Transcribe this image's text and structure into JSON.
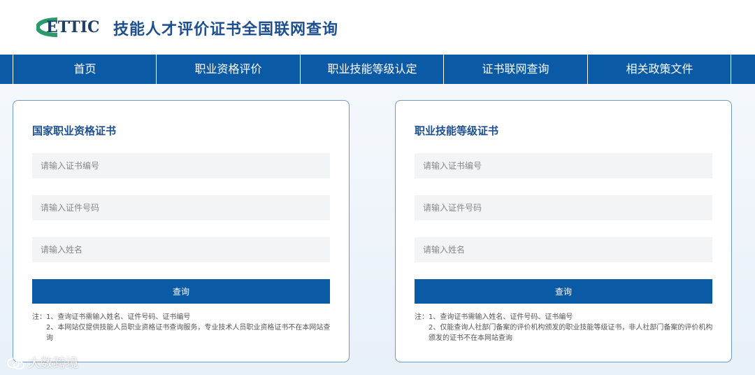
{
  "header": {
    "logo_text": "ETTIC",
    "title": "技能人才评价证书全国联网查询"
  },
  "nav": {
    "items": [
      {
        "label": "首页"
      },
      {
        "label": "职业资格评价"
      },
      {
        "label": "职业技能等级认定"
      },
      {
        "label": "证书联网查询"
      },
      {
        "label": "相关政策文件"
      }
    ]
  },
  "panels": {
    "left": {
      "title": "国家职业资格证书",
      "cert_no_placeholder": "请输入证书编号",
      "id_no_placeholder": "请输入证件号码",
      "name_placeholder": "请输入姓名",
      "button_label": "查询",
      "note_line1": "注：1、查询证书需输入姓名、证件号码、证书编号",
      "note_line2": "2、本网站仅提供技能人员职业资格证书查询服务，专业技术人员职业资格证书不在本网站查询"
    },
    "right": {
      "title": "职业技能等级证书",
      "cert_no_placeholder": "请输入证书编号",
      "id_no_placeholder": "请输入证件号码",
      "name_placeholder": "请输入姓名",
      "button_label": "查询",
      "note_line1": "注：1、查询证书需输入姓名、证件号码、证书编号",
      "note_line2": "2、仅能查询人社部门备案的评价机构颁发的职业技能等级证书，非人社部门备案的评价机构颁发的证书不在本网站查询"
    }
  },
  "watermark": {
    "text": "大数跨境"
  },
  "colors": {
    "brand_blue": "#0b5aa6",
    "title_blue": "#1e4f8f",
    "panel_border": "#6f99c6",
    "logo_green": "#2a9a6a"
  }
}
